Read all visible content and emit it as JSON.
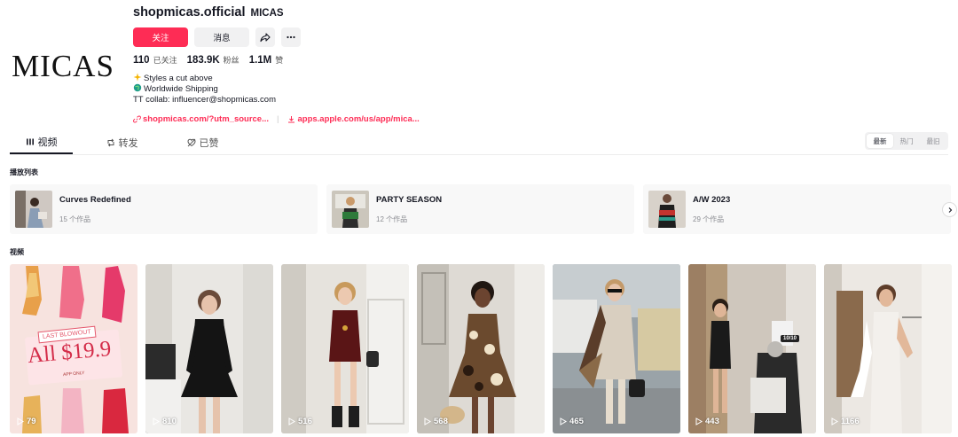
{
  "profile": {
    "avatar_logo": "MICAS",
    "username": "shopmicas.official",
    "nickname": "MICAS",
    "follow_label": "关注",
    "message_label": "消息",
    "stats": [
      {
        "num": "110",
        "label": "已关注"
      },
      {
        "num": "183.9K",
        "label": "粉丝"
      },
      {
        "num": "1.1M",
        "label": "赞"
      }
    ],
    "bio": [
      "Styles a cut above",
      "Worldwide Shipping",
      "TT collab: influencer@shopmicas.com"
    ],
    "link1": "shopmicas.com/?utm_source...",
    "link2": "apps.apple.com/us/app/mica...",
    "accent": "#fe2c55"
  },
  "tabs": [
    {
      "label": "视频",
      "icon": "grid-icon"
    },
    {
      "label": "转发",
      "icon": "repost-icon"
    },
    {
      "label": "已赞",
      "icon": "liked-icon"
    }
  ],
  "sort": [
    "最新",
    "热门",
    "最旧"
  ],
  "playlist_section": "播放列表",
  "playlists": [
    {
      "title": "Curves Redefined",
      "count": "15 个作品"
    },
    {
      "title": "PARTY SEASON",
      "count": "12 个作品"
    },
    {
      "title": "A/W 2023",
      "count": "29 个作品"
    }
  ],
  "video_section": "视频",
  "promo": {
    "badge": "LAST BLOWOUT",
    "price": "All $19.9",
    "sub": "APP ONLY"
  },
  "score_badge": "10/10",
  "videos": [
    {
      "views": "79"
    },
    {
      "views": "810"
    },
    {
      "views": "516"
    },
    {
      "views": "568"
    },
    {
      "views": "465"
    },
    {
      "views": "443"
    },
    {
      "views": "1166"
    }
  ]
}
